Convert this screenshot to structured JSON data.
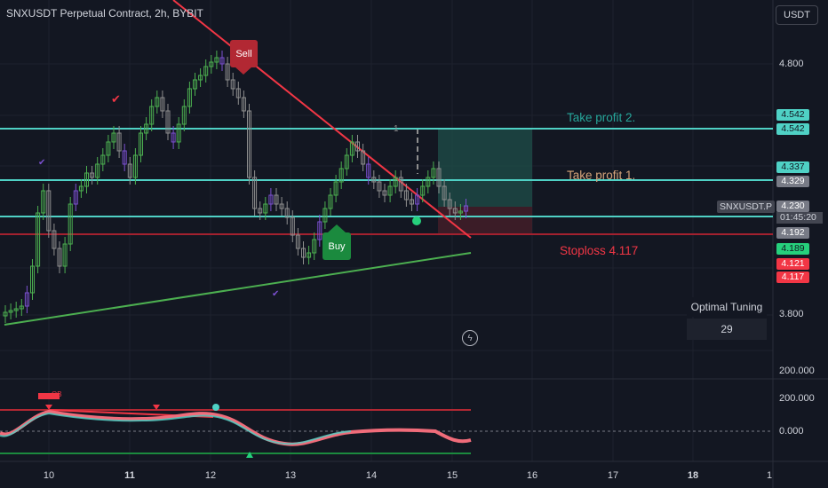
{
  "header": {
    "title": "SNXUSDT Perpetual Contract, 2h, BYBIT",
    "currency": "USDT"
  },
  "price_axis": {
    "labels": [
      "4.800",
      "3.800",
      "200.000",
      "200.000",
      "0.000"
    ],
    "tags": {
      "tp2_a": "4.542",
      "tp2_b": "4.542",
      "tp1_a": "4.337",
      "tp1_b": "4.329",
      "current": "4.230",
      "countdown": "01:45:20",
      "p4192": "4.192",
      "p4189": "4.189",
      "p4121": "4.121",
      "p4117": "4.117"
    }
  },
  "time_axis": {
    "labels": [
      "10",
      "11",
      "12",
      "13",
      "14",
      "15",
      "16",
      "17",
      "18",
      "1"
    ]
  },
  "chart": {
    "symbol_tag": "SNXUSDT.P",
    "take_profit_2": "Take profit 2.",
    "take_profit_1": "Take profit 1.",
    "stoploss": "Stoploss 4.117",
    "sell_label": "Sell",
    "buy_label": "Buy",
    "tuning_title": "Optimal Tuning",
    "tuning_value": "29",
    "ob_label": "OB",
    "position_marker": "1"
  },
  "colors": {
    "background": "#131722",
    "teal": "#4fd1c5",
    "green": "#26d07c",
    "red": "#f23645",
    "candle_up": "#4caf50",
    "candle_down": "#8e8e8e",
    "candle_purple": "#7b50d0"
  },
  "chart_data": {
    "type": "candlestick",
    "instrument": "SNXUSDT Perpetual Contract",
    "timeframe": "2h",
    "exchange": "BYBIT",
    "x_ticks": [
      "10",
      "11",
      "12",
      "13",
      "14",
      "15",
      "16",
      "17",
      "18",
      "1"
    ],
    "y_ticks": [
      4.8,
      3.8
    ],
    "levels": [
      {
        "name": "Take profit 2.",
        "value": 4.542
      },
      {
        "name": "Take profit 1.",
        "value": 4.329
      },
      {
        "name": "Current",
        "value": 4.23
      },
      {
        "name": "Stoploss 4.117",
        "value": 4.117
      }
    ],
    "signals": [
      {
        "label": "Sell",
        "day": 12.4
      },
      {
        "label": "Buy",
        "day": 13.6
      }
    ]
  }
}
